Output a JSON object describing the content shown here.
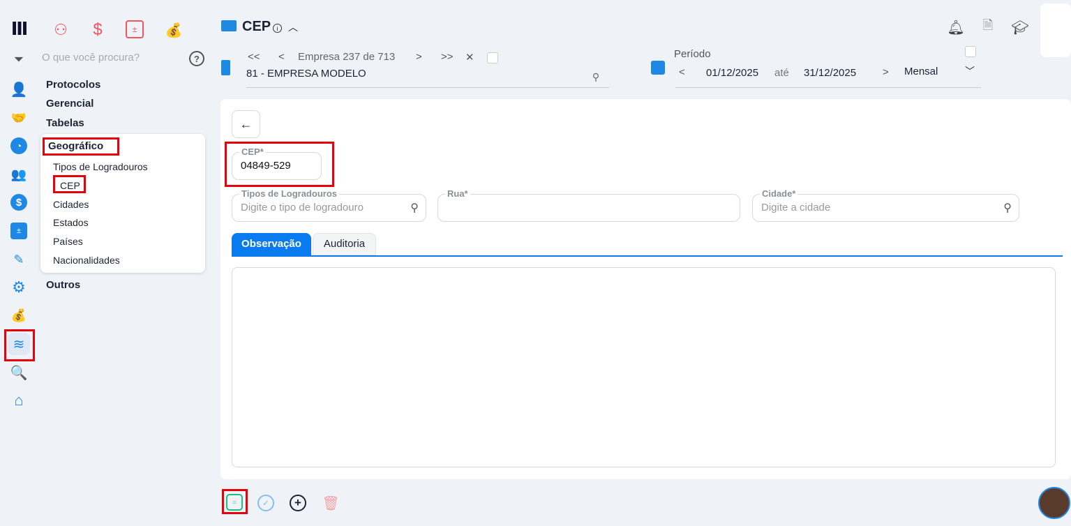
{
  "topbar": {
    "title": "CEP",
    "search_placeholder": "O que você procura?"
  },
  "company": {
    "nav_text": "Empresa 237 de 713",
    "value": "81 - EMPRESA MODELO",
    "first": "<<",
    "prev": "<",
    "next": ">",
    "last": ">>",
    "clear": "✕"
  },
  "period": {
    "label": "Período",
    "start": "01/12/2025",
    "until": "até",
    "end": "31/12/2025",
    "mode": "Mensal"
  },
  "menu": {
    "protocolos": "Protocolos",
    "gerencial": "Gerencial",
    "tabelas": "Tabelas",
    "geografico": "Geográfico",
    "items": [
      "Tipos de Logradouros",
      "CEP",
      "Cidades",
      "Estados",
      "Países",
      "Nacionalidades"
    ],
    "outros": "Outros"
  },
  "form": {
    "cep_label": "CEP*",
    "cep_value": "04849-529",
    "tipos_label": "Tipos de Logradouros",
    "tipos_placeholder": "Digite o tipo de logradouro",
    "rua_label": "Rua*",
    "rua_value": "",
    "cidade_label": "Cidade*",
    "cidade_placeholder": "Digite a cidade"
  },
  "tabs": [
    "Observação",
    "Auditoria"
  ],
  "colors": {
    "accent": "#0a7bef",
    "save": "#1fbf7f",
    "danger": "#f4a2a8",
    "highlight": "#e8000b"
  }
}
